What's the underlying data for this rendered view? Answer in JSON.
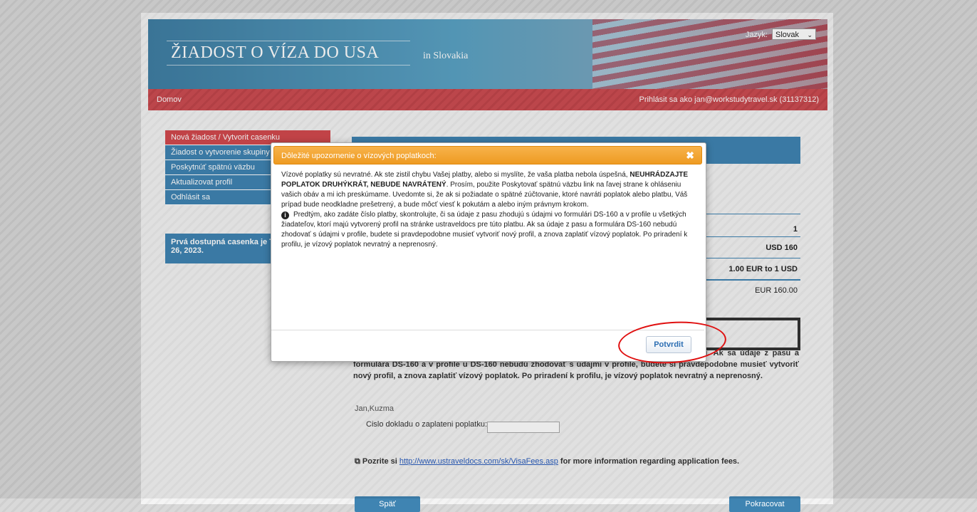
{
  "header": {
    "title": "ŽIADOST O VÍZA DO USA",
    "subtitle": "in Slovakia",
    "language_label": "Jazyk:",
    "language_value": "Slovak"
  },
  "navbar": {
    "home": "Domov",
    "login": "Prihlásit sa ako  jan@workstudytravel.sk (31137312)"
  },
  "sidebar": {
    "items": [
      {
        "label": "Nová žiadost / Vytvorit casenku"
      },
      {
        "label": "Žiadost o vytvorenie skupiny"
      },
      {
        "label": "Poskytnúť spätnú väzbu"
      },
      {
        "label": "Aktualizovat profil"
      },
      {
        "label": "Odhlásit sa"
      }
    ],
    "info": "Prvá dostupná casenka je T... January 26, 2023."
  },
  "content": {
    "applicants": "1",
    "fee": "USD 160",
    "rate": "1.00 EUR to 1 USD",
    "total": "EUR 160.00",
    "paragraph": "u všetkých žiadateľov, ktorí majú vytvorený profil na stránke ustraveldocs pre túto platbu. Ak sa údaje z pasu a formulára DS-160 a v profile u DS-160 nebudú zhodovať s údajmi v profile, budete si pravdepodobne musieť vytvoriť nový profil, a znova zaplatiť vízový poplatok. Po priradení k profilu, je vízový poplatok nevratný a neprenosný.",
    "name": "Jan,Kuzma",
    "pay_label": "Cislo dokladu o zaplateni poplatku:",
    "note_prefix": "Pozrite si",
    "note_link": "http://www.ustraveldocs.com/sk/VisaFees.asp",
    "note_suffix": "for more information regarding application fees.",
    "back_button": "Späť",
    "continue_button": "Pokracovat"
  },
  "modal": {
    "title": "Dôležité upozornenie o vízových poplatkoch:",
    "close": "✖",
    "p1_normal": "Vízové poplatky sú nevratné. Ak ste zistil chybu Vašej platby, alebo si myslíte, že vaša platba nebola úspešná, ",
    "p1_bold": "NEUHRÁDZAJTE POPLATOK DRUHÝKRÁT, NEBUDE NAVRÁTENÝ",
    "p1_rest": ". Prosím, použite Poskytovať spätnú väzbu link na ľavej strane k ohláseniu vašich obáv a mi ich preskúmame. Uvedomte si, že ak si požiadate o spätné zúčtovanie, ktoré navráti poplatok alebo platbu, Váš prípad bude neodkladne prešetrený, a bude môcť viesť k pokutám a alebo iným  právnym krokom.",
    "p2": "Predtým, ako zadáte číslo platby, skontrolujte, či sa údaje z pasu zhodujú s údajmi vo formulári DS-160 a v profile u všetkých žiadateľov, ktorí majú vytvorený profil na stránke ustraveldocs pre túto platbu. Ak sa údaje z pasu a formulára DS-160 nebudú zhodovať s údajmi v profile, budete si pravdepodobne musieť vytvoriť nový profil, a znova zaplatiť vízový poplatok. Po priradení k profilu, je vízový poplatok nevratný a neprenosný.",
    "confirm": "Potvrdit"
  }
}
